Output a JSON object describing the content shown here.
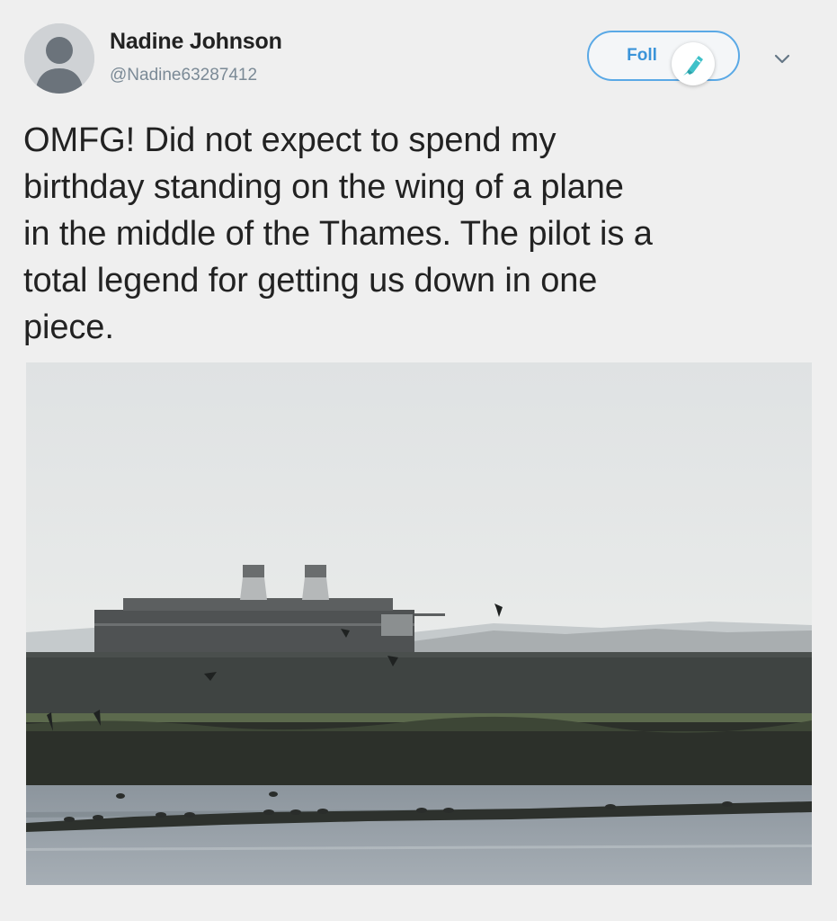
{
  "tweet": {
    "author_name": "Nadine Johnson",
    "author_handle": "@Nadine63287412",
    "follow_label": "Foll",
    "text_lines": [
      "OMFG! Did not expect to spend my",
      "birthday standing on the wing of a plane",
      "in the middle of the Thames. The pilot is a",
      "total legend for getting us down in one",
      "piece."
    ]
  },
  "icons": {
    "avatar": "default-avatar-icon",
    "edit_badge": "highlighter-pen-icon",
    "menu": "chevron-down-icon"
  },
  "colors": {
    "background": "#efefef",
    "follow_border": "#5aa9e6",
    "follow_text": "#3b94d9",
    "badge_pen": "#3fc1c9",
    "handle_text": "#7b8a96"
  }
}
